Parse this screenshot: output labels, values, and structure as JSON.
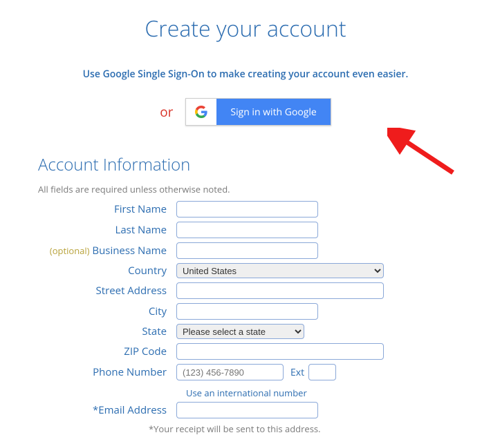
{
  "title": "Create your account",
  "ssoHint": "Use Google Single Sign-On to make creating your account even easier.",
  "orText": "or",
  "googleButton": "Sign in with Google",
  "section": "Account Information",
  "fieldsNote": "All fields are required unless otherwise noted.",
  "optionalTag": "(optional)",
  "labels": {
    "firstName": "First Name",
    "lastName": "Last Name",
    "businessName": " Business Name",
    "country": "Country",
    "streetAddress": "Street Address",
    "city": "City",
    "state": "State",
    "zip": "ZIP Code",
    "phone": "Phone Number",
    "ext": "Ext",
    "email": "*Email Address"
  },
  "values": {
    "country": "United States",
    "state": "Please select a state",
    "phonePlaceholder": "(123) 456-7890"
  },
  "intlLink": "Use an international number",
  "receiptNote": "*Your receipt will be sent to this address."
}
